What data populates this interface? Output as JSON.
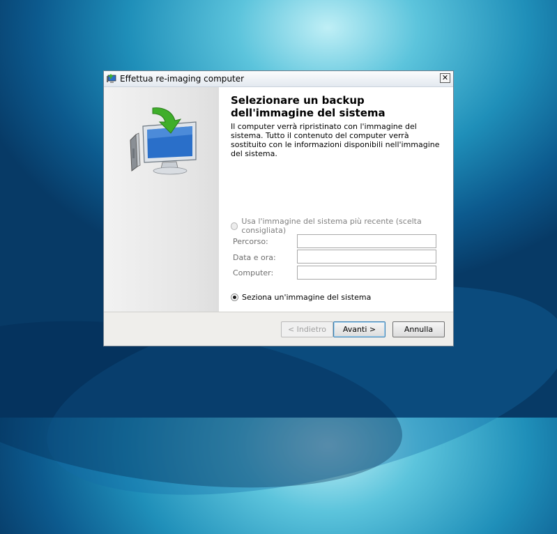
{
  "window": {
    "title": "Effettua re-imaging computer",
    "close_symbol": "✕"
  },
  "page": {
    "heading": "Selezionare un backup dell'immagine del sistema",
    "description": "Il computer verrà ripristinato con l'immagine del sistema. Tutto il contenuto del computer verrà sostituito con le informazioni disponibili nell'immagine del sistema."
  },
  "options": {
    "latest_label": "Usa l'immagine del sistema più recente (scelta consigliata)",
    "latest_checked": false,
    "latest_enabled": false,
    "select_label": "Seziona un'immagine del sistema",
    "select_checked": true
  },
  "fields": {
    "path_label": "Percorso:",
    "path_value": "",
    "datetime_label": "Data e ora:",
    "datetime_value": "",
    "computer_label": "Computer:",
    "computer_value": ""
  },
  "buttons": {
    "back": "< Indietro",
    "next": "Avanti >",
    "cancel": "Annulla"
  },
  "icons": {
    "app": "backup-restore-icon",
    "illustration": "monitor-restore-arrow-icon",
    "close": "close-icon"
  },
  "colors": {
    "title_bar": "#e3e9f0",
    "arrow_green": "#3fae2a",
    "screen_blue": "#2a6fc9"
  }
}
